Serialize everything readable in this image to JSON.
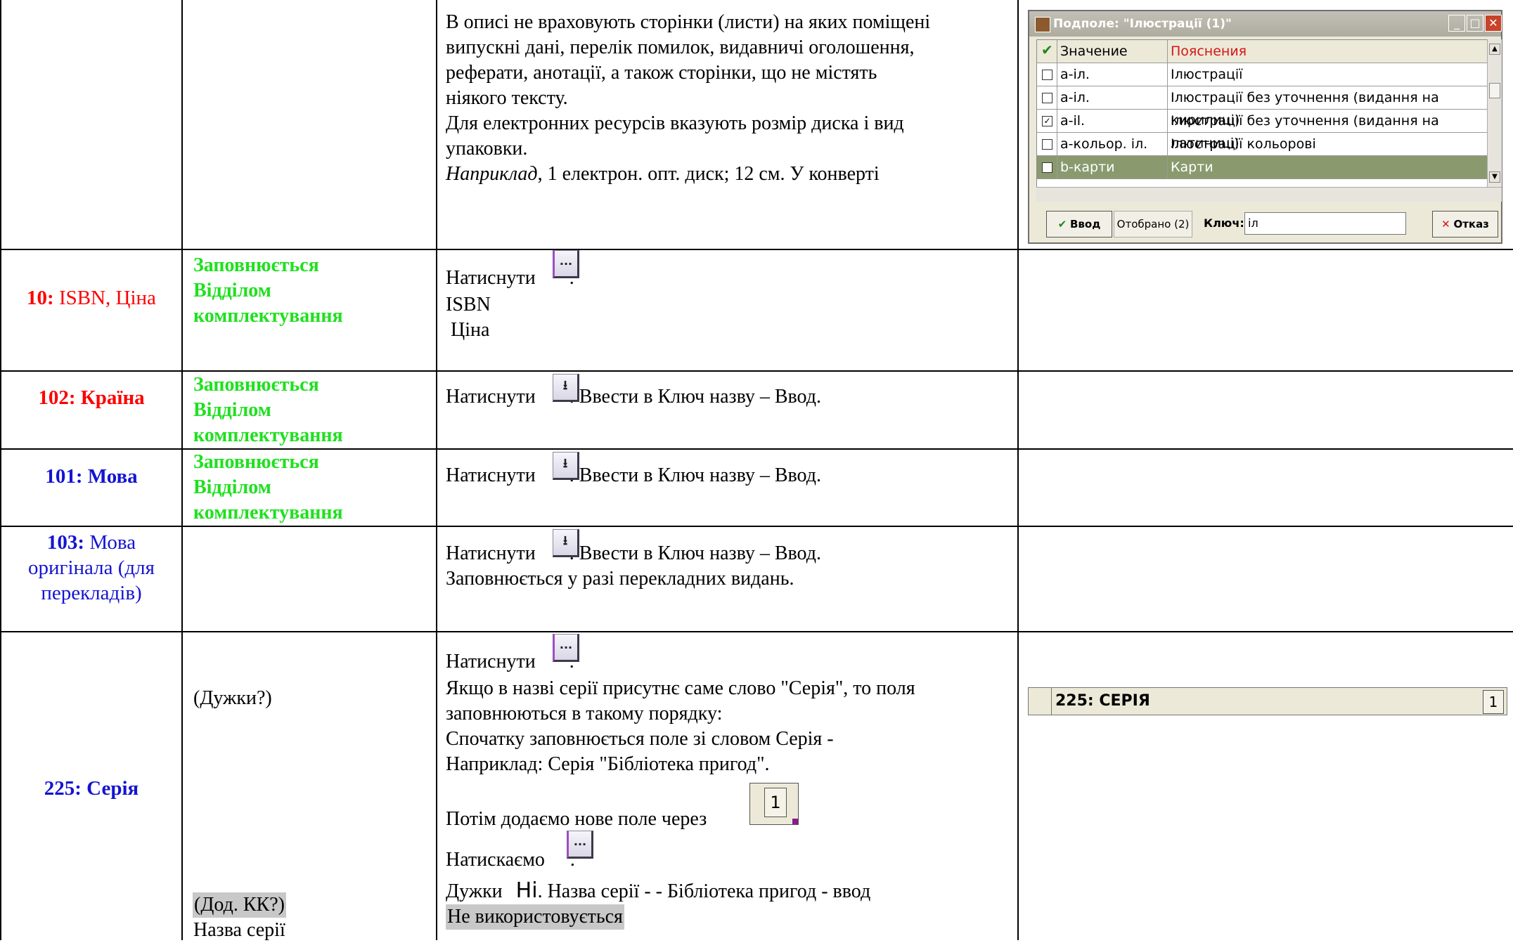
{
  "row_top": {
    "description_lines": [
      "В описі не враховують сторінки (листи) на яких поміщені",
      "випускні дані, перелік помилок, видавничі оголошення,",
      "реферати, анотації, а також сторінки, що не містять",
      "ніякого тексту.",
      "Для електронних ресурсів вказують розмір диска і вид",
      "упаковки."
    ],
    "example_italic": "Наприклад",
    "example_rest": ", 1 електрон. опт. диск; 12 см. У конверті"
  },
  "dialog": {
    "title": "Подполе: \"Ілюстрації (1)\"",
    "header_col1": "Значение",
    "header_col2": "Пояснения",
    "rows": [
      {
        "value": "a-іл.",
        "explanation": "Ілюстрації",
        "checked": false,
        "selected": false
      },
      {
        "value": "a-іл.",
        "explanation": "Ілюстрації без уточнення (видання на кирилиці)",
        "checked": false,
        "selected": false
      },
      {
        "value": "a-il.",
        "explanation": "Ілюстрації без уточнення (видання на латиниці)",
        "checked": true,
        "selected": false
      },
      {
        "value": "a-кольор. іл.",
        "explanation": "Ілюстрації кольорові",
        "checked": false,
        "selected": false
      },
      {
        "value": "b-карти",
        "explanation": "Карти",
        "checked": true,
        "selected": true
      }
    ],
    "ok_label": "Ввод",
    "selected_label": "Отобрано (2)",
    "key_label": "Ключ:",
    "key_value": "іл",
    "cancel_label": "Отказ"
  },
  "rows": [
    {
      "field_num": "10:",
      "field_name": " ISBN, Ціна",
      "filled_by": [
        "Заповнюється",
        "Відділом",
        "комплектування"
      ],
      "press": "Натиснути",
      "lines": [
        "ISBN",
        " Ціна"
      ]
    },
    {
      "field_label": "102: Країна",
      "filled_by": [
        "Заповнюється",
        "Відділом",
        "комплектування"
      ],
      "press": "Натиснути",
      "after": ". Ввести в Ключ назву – Ввод."
    },
    {
      "field_label": "101: Мова",
      "filled_by": [
        "Заповнюється",
        "Відділом",
        "комплектування"
      ],
      "press": "Натиснути",
      "after": ". Ввести в Ключ назву – Ввод."
    },
    {
      "field_num": "103:",
      "field_name_lines": [
        " Мова",
        "оригінала (для",
        "перекладів)"
      ],
      "press": "Натиснути",
      "after": ". Ввести в Ключ назву – Ввод.",
      "note": "Заповнюється у разі перекладних видань."
    },
    {
      "field_label": "225: Серія",
      "note_brackets": "(Дужки?)",
      "note_extra": "(Дод. КК?)",
      "note_series": "Назва серії",
      "press": "Натиснути",
      "lines": [
        "Якщо в назві серії присутнє саме слово \"Серія\", то поля",
        "заповнюються в такому порядку:",
        "Спочатку заповнюється поле зі словом Серія -",
        "Наприклад: Серія \"Бібліотека пригод\"."
      ],
      "add_field": "Потім додаємо нове поле через",
      "add_counter": "1",
      "press2": "Натискаємо",
      "brackets_line_a": "Дужки",
      "brackets_line_b": "Ні",
      "brackets_line_c": ". Назва серії - - Бібліотека пригод - ввод",
      "unused": "Не використовується",
      "field_bar_label": "225: СЕРІЯ",
      "field_bar_counter": "1"
    }
  ]
}
